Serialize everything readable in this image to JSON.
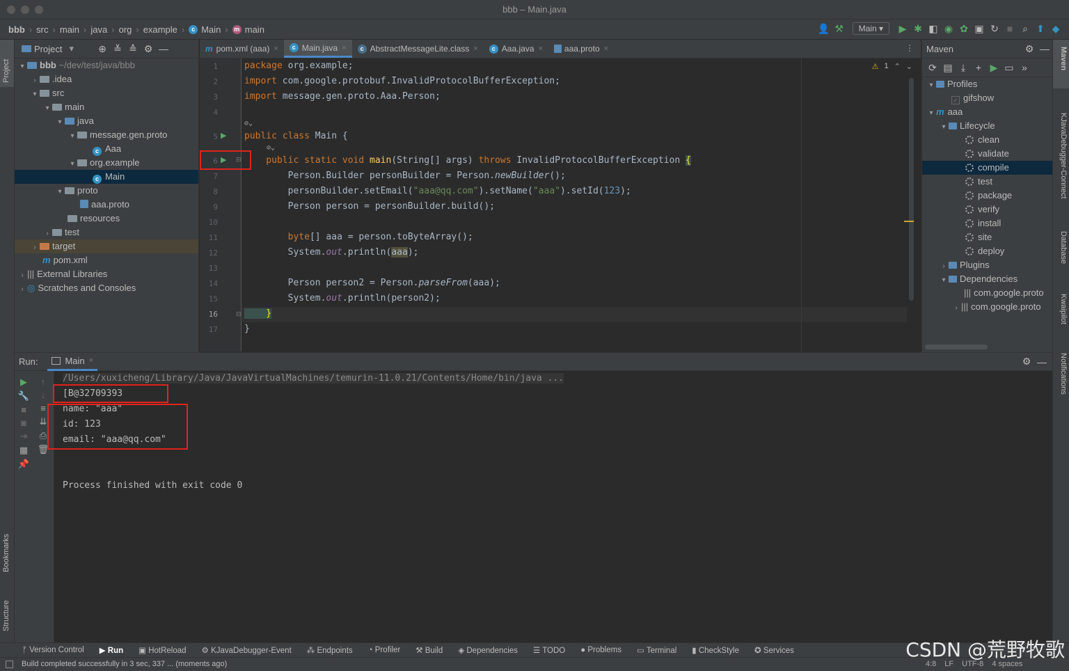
{
  "window": {
    "title": "bbb – Main.java"
  },
  "breadcrumb": [
    "bbb",
    "src",
    "main",
    "java",
    "org",
    "example",
    "Main",
    "main"
  ],
  "toolbar": {
    "run_config": "Main"
  },
  "left_strip": {
    "project": "Project",
    "bookmarks": "Bookmarks",
    "structure": "Structure"
  },
  "right_strip": {
    "maven": "Maven",
    "kjava": "KJavaDebugger-Connect",
    "database": "Database",
    "kwaipilot": "Kwaipilot",
    "notifications": "Notifications"
  },
  "project_panel": {
    "title": "Project",
    "tree": [
      {
        "label": "bbb",
        "suffix": "~/dev/test/java/bbb"
      },
      {
        "label": ".idea"
      },
      {
        "label": "src"
      },
      {
        "label": "main"
      },
      {
        "label": "java"
      },
      {
        "label": "message.gen.proto"
      },
      {
        "label": "Aaa"
      },
      {
        "label": "org.example"
      },
      {
        "label": "Main"
      },
      {
        "label": "proto"
      },
      {
        "label": "aaa.proto"
      },
      {
        "label": "resources"
      },
      {
        "label": "test"
      },
      {
        "label": "target"
      },
      {
        "label": "pom.xml"
      },
      {
        "label": "External Libraries"
      },
      {
        "label": "Scratches and Consoles"
      }
    ]
  },
  "editor_tabs": [
    {
      "label": "pom.xml (aaa)"
    },
    {
      "label": "Main.java"
    },
    {
      "label": "AbstractMessageLite.class"
    },
    {
      "label": "Aaa.java"
    },
    {
      "label": "aaa.proto"
    }
  ],
  "editor": {
    "warning_count": "1",
    "line_numbers": [
      "1",
      "2",
      "3",
      "4",
      "5",
      "6",
      "7",
      "8",
      "9",
      "10",
      "11",
      "12",
      "13",
      "14",
      "15",
      "16",
      "17"
    ],
    "code": {
      "l1a": "package",
      "l1b": " org.example;",
      "l2a": "import",
      "l2b": " com.google.protobuf.InvalidProtocolBufferException;",
      "l3a": "import",
      "l3b": " message.gen.proto.Aaa.Person;",
      "l5a": "public class",
      "l5b": " Main {",
      "l6a": "    public static void ",
      "l6b": "main",
      "l6c": "(String[] args) ",
      "l6d": "throws",
      "l6e": " InvalidProtocolBufferException ",
      "l6f": "{",
      "l7a": "        Person.Builder personBuilder = Person.",
      "l7b": "newBuilder",
      "l7c": "();",
      "l8a": "        personBuilder.setEmail(",
      "l8b": "\"aaa@qq.com\"",
      "l8c": ").setName(",
      "l8d": "\"aaa\"",
      "l8e": ").setId(",
      "l8f": "123",
      "l8g": ");",
      "l9a": "        Person person = personBuilder.build();",
      "l11a": "        ",
      "l11b": "byte",
      "l11c": "[] aaa = person.toByteArray();",
      "l12a": "        System.",
      "l12b": "out",
      "l12c": ".println(",
      "l12d": "aaa",
      "l12e": ");",
      "l14a": "        Person person2 = Person.",
      "l14b": "parseFrom",
      "l14c": "(aaa);",
      "l15a": "        System.",
      "l15b": "out",
      "l15c": ".println(person2);",
      "l16a": "    }",
      "l17a": "}"
    }
  },
  "maven_panel": {
    "title": "Maven",
    "items": [
      {
        "label": "Profiles"
      },
      {
        "label": "gifshow"
      },
      {
        "label": "aaa"
      },
      {
        "label": "Lifecycle"
      },
      {
        "label": "clean"
      },
      {
        "label": "validate"
      },
      {
        "label": "compile"
      },
      {
        "label": "test"
      },
      {
        "label": "package"
      },
      {
        "label": "verify"
      },
      {
        "label": "install"
      },
      {
        "label": "site"
      },
      {
        "label": "deploy"
      },
      {
        "label": "Plugins"
      },
      {
        "label": "Dependencies"
      },
      {
        "label": "com.google.proto"
      },
      {
        "label": "com.google.proto"
      }
    ]
  },
  "run_panel": {
    "label": "Run:",
    "tab": "Main",
    "console": [
      "/Users/xuxicheng/Library/Java/JavaVirtualMachines/temurin-11.0.21/Contents/Home/bin/java ...",
      "[B@32709393",
      "name: \"aaa\"",
      "id: 123",
      "email: \"aaa@qq.com\"",
      "Process finished with exit code 0"
    ]
  },
  "bottom_tools": [
    "Version Control",
    "Run",
    "HotReload",
    "KJavaDebugger-Event",
    "Endpoints",
    "Profiler",
    "Build",
    "Dependencies",
    "TODO",
    "Problems",
    "Terminal",
    "CheckStyle",
    "Services"
  ],
  "status": {
    "message": "Build completed successfully in 3 sec, 337 ... (moments ago)",
    "position": "4:8",
    "line_sep": "LF",
    "encoding": "UTF-8",
    "indent": "4 spaces"
  },
  "watermark": "CSDN @荒野牧歌"
}
